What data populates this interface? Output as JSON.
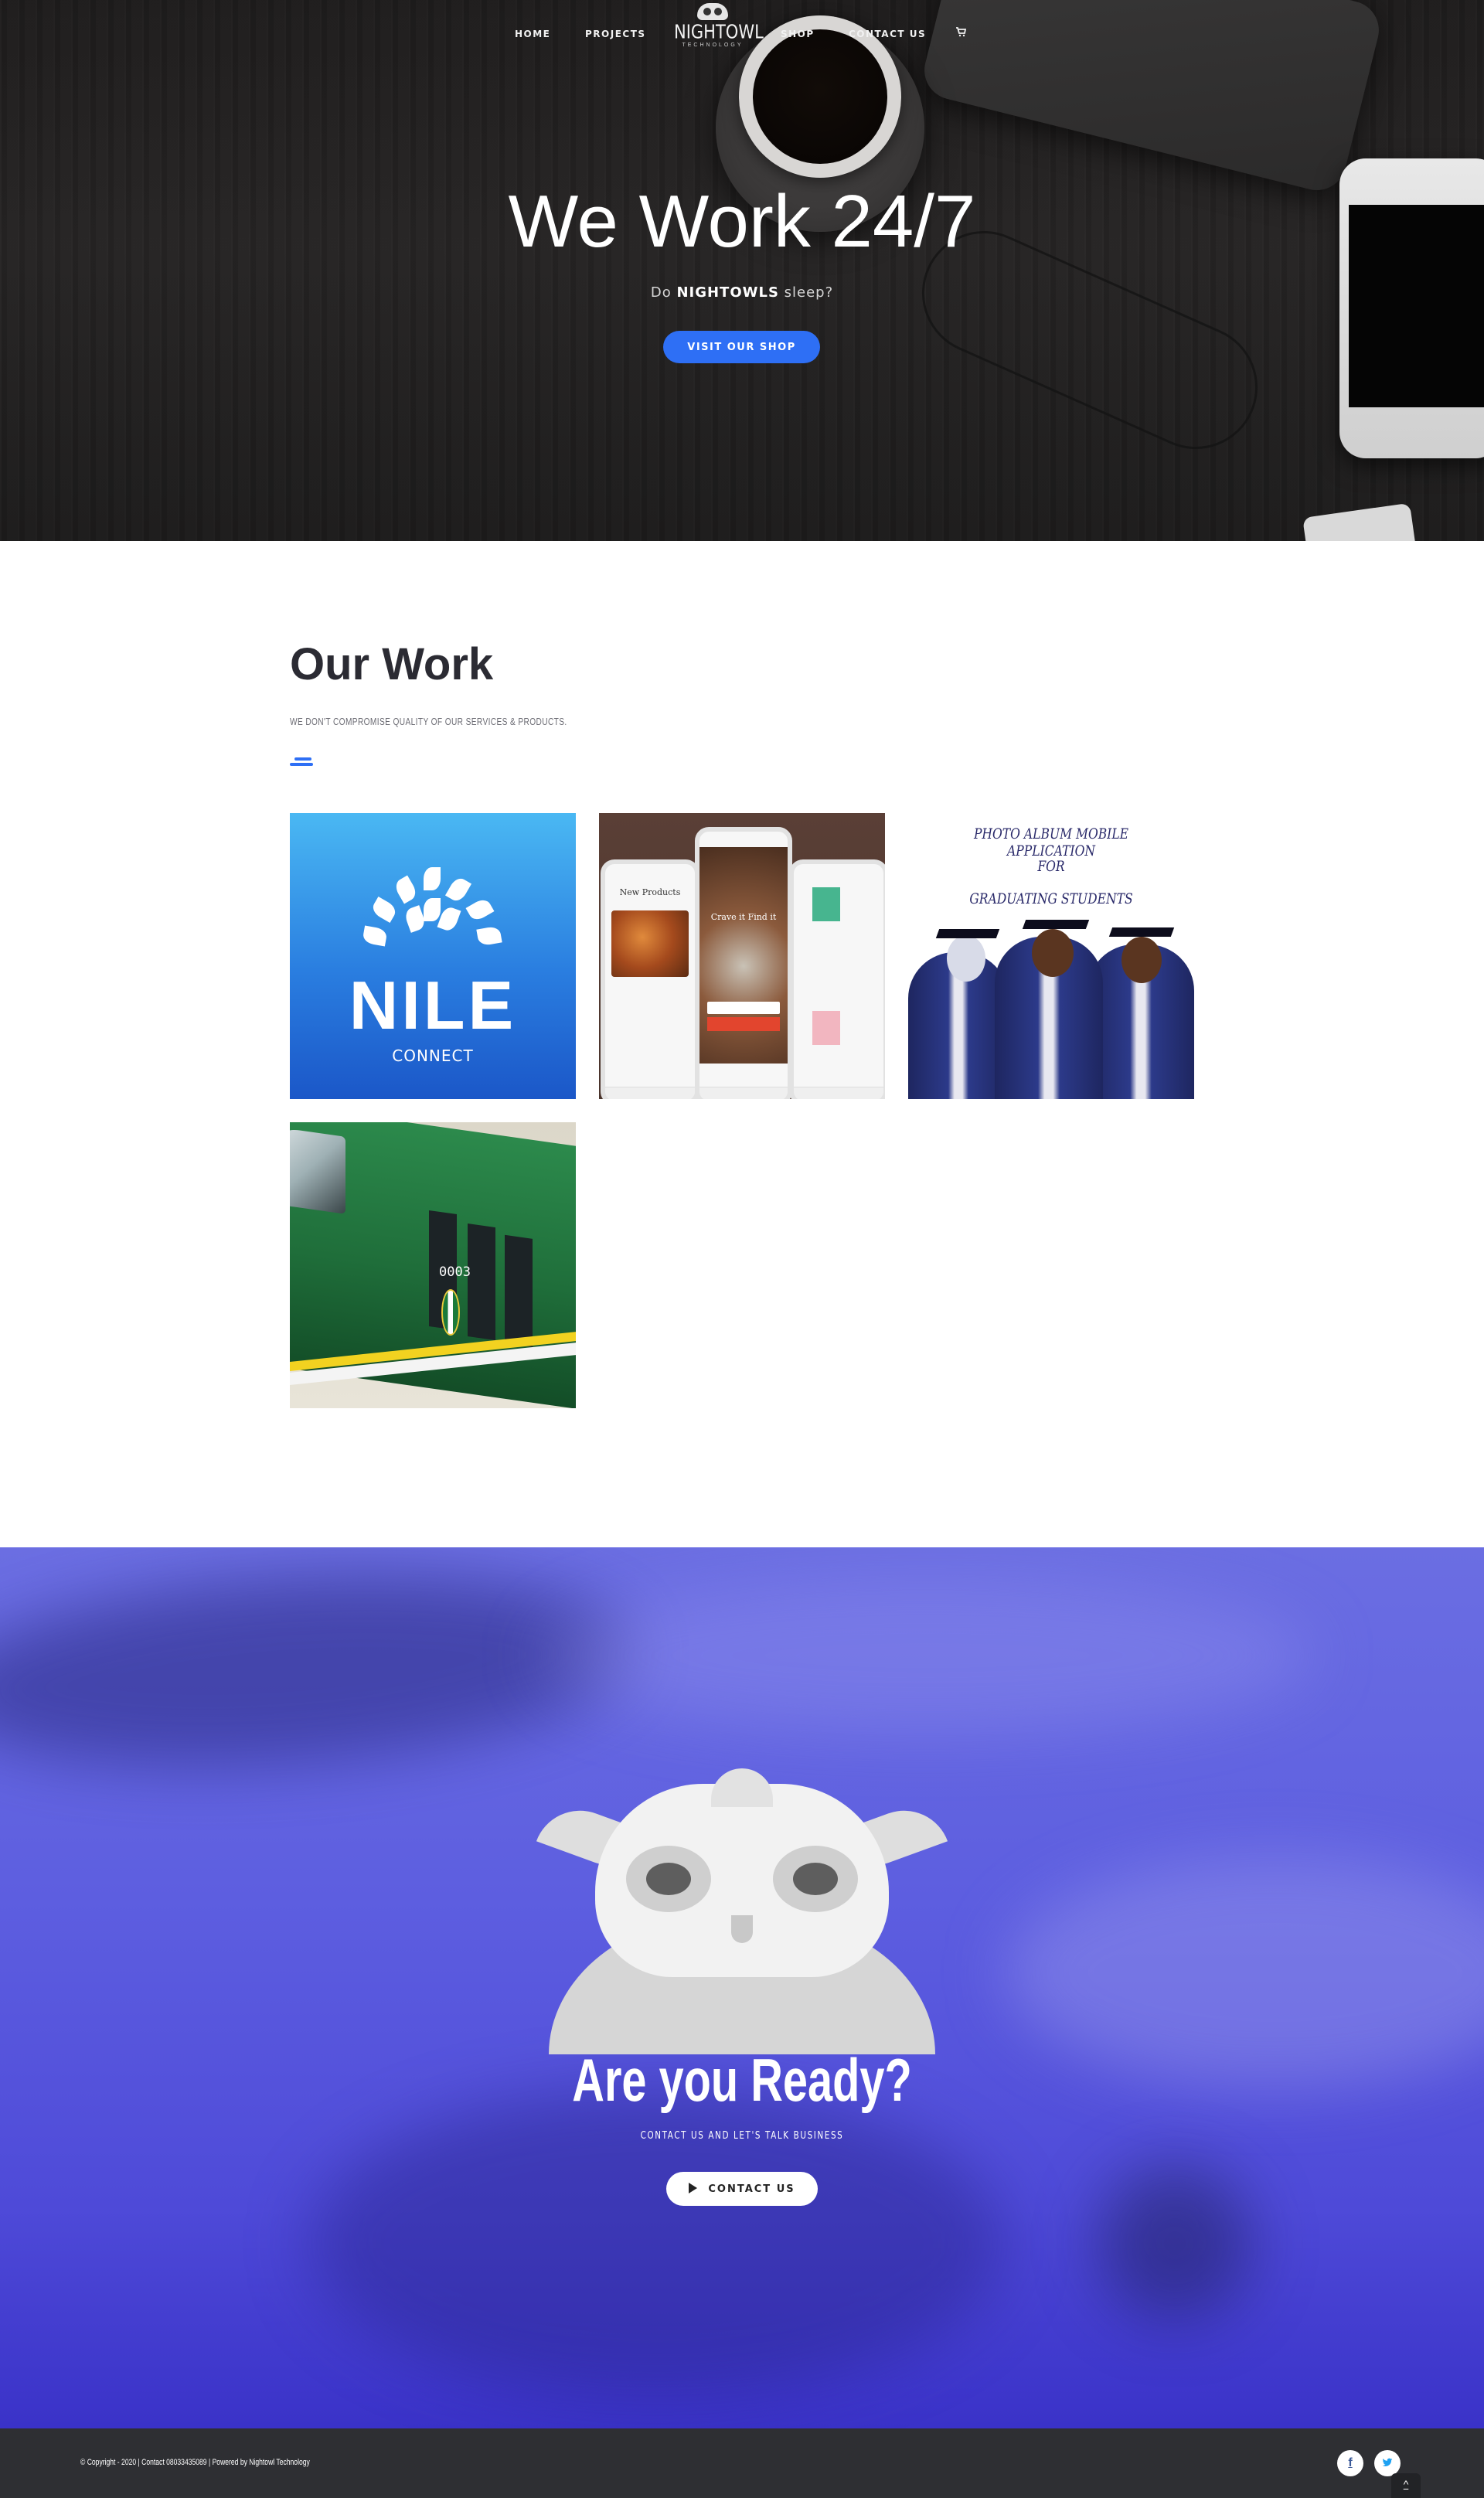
{
  "nav": {
    "home": "HOME",
    "projects": "PROJECTS",
    "shop": "SHOP",
    "contact": "CONTACT US",
    "cart_icon": "cart-icon"
  },
  "logo": {
    "name": "NIGHTOWL",
    "sub": "TECHNOLOGY"
  },
  "hero": {
    "title": "We Work 24/7",
    "tagline_prefix": "Do",
    "tagline_bold": "NIGHTOWLS",
    "tagline_suffix": "sleep?",
    "button": "VISIT OUR SHOP"
  },
  "work": {
    "title": "Our Work",
    "subtitle": "WE DON'T COMPROMISE QUALITY OF OUR SERVICES & PRODUCTS.",
    "tiles": [
      {
        "word": "NILE",
        "sub": "CONNECT"
      },
      {
        "screen1": "New Products",
        "screen2": "Crave it Find it"
      },
      {
        "line1": "PHOTO ALBUM MOBILE APPLICATION",
        "line2": "FOR",
        "line3": "GRADUATING STUDENTS"
      },
      {
        "number": "0003"
      }
    ]
  },
  "cta": {
    "title": "Are you Ready?",
    "subtitle": "CONTACT US AND LET'S TALK BUSINESS",
    "button": "CONTACT US"
  },
  "footer": {
    "copyright": "© Copyright - 2020 | Contact 08033435089 | Powered by Nightowl Technology",
    "facebook": "f",
    "twitter": "t",
    "top": "^"
  },
  "colors": {
    "accent": "#2e6ff5",
    "cta_bg": "#5d5ee0",
    "footer_bg": "#2e2f33"
  }
}
